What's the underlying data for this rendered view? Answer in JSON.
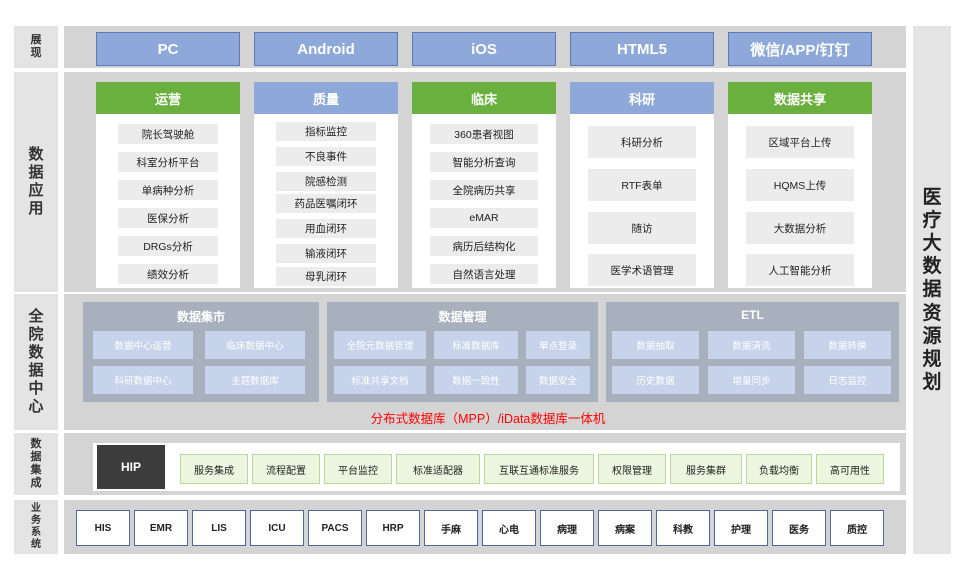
{
  "side_labels": {
    "display": "展现",
    "application": "数据应用",
    "data_center": "全院数据中心",
    "integration": "数据集成",
    "business": "业务系统"
  },
  "right_title": "医疗大数据资源规划",
  "platforms": [
    "PC",
    "Android",
    "iOS",
    "HTML5",
    "微信/APP/钉钉"
  ],
  "app_columns": [
    {
      "title": "运营",
      "items": [
        "院长驾驶舱",
        "科室分析平台",
        "单病种分析",
        "医保分析",
        "DRGs分析",
        "绩效分析"
      ]
    },
    {
      "title": "质量",
      "items": [
        "指标监控",
        "不良事件",
        "院感检测",
        "药品医嘱闭环",
        "用血闭环",
        "输液闭环",
        "母乳闭环"
      ]
    },
    {
      "title": "临床",
      "items": [
        "360患者视图",
        "智能分析查询",
        "全院病历共享",
        "eMAR",
        "病历后结构化",
        "自然语言处理"
      ]
    },
    {
      "title": "科研",
      "items": [
        "科研分析",
        "RTF表单",
        "随访",
        "医学术语管理"
      ]
    },
    {
      "title": "数据共享",
      "items": [
        "区域平台上传",
        "HQMS上传",
        "大数据分析",
        "人工智能分析"
      ]
    }
  ],
  "data_center": {
    "mart": {
      "title": "数据集市",
      "items": [
        "数据中心运营",
        "临床数据中心",
        "科研数据中心",
        "主题数据库"
      ]
    },
    "mgmt": {
      "title": "数据管理",
      "items": [
        "全院元数据管理",
        "标准数据库",
        "单点登录",
        "标准共享文档",
        "数据一致性",
        "数据安全"
      ]
    },
    "etl": {
      "title": "ETL",
      "items": [
        "数据抽取",
        "数据清洗",
        "数据转换",
        "历史数据",
        "增量同步",
        "日志监控"
      ]
    },
    "footer": "分布式数据库（MPP）/iData数据库一体机"
  },
  "integration": {
    "hip": "HIP",
    "items": [
      "服务集成",
      "流程配置",
      "平台监控",
      "标准适配器",
      "互联互通标准服务",
      "权限管理",
      "服务集群",
      "负载均衡",
      "高可用性"
    ]
  },
  "business_systems": [
    "HIS",
    "EMR",
    "LIS",
    "ICU",
    "PACS",
    "HRP",
    "手麻",
    "心电",
    "病理",
    "病案",
    "科教",
    "护理",
    "医务",
    "质控"
  ],
  "colors": {
    "green_header": "#6ab03e",
    "blue_header": "#8ea8d9",
    "panel_gray": "#d4d4d4",
    "group_gray": "#a8b0bd",
    "cell_blue": "#c7d3ea",
    "accent_red": "#ff0000",
    "hip_dark": "#3c3c3c"
  }
}
